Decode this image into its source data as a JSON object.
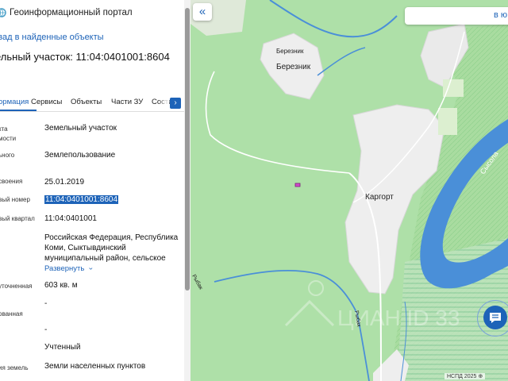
{
  "header": {
    "title": "Геоинформационный портал",
    "back_link": "зад в найденные объекты",
    "object_title": "ельный участок: 11:04:0401001:8604"
  },
  "tabs": [
    {
      "label": "ормация",
      "active": true
    },
    {
      "label": "Сервисы",
      "active": false
    },
    {
      "label": "Объекты",
      "active": false
    },
    {
      "label": "Части ЗУ",
      "active": false
    },
    {
      "label": "Соста",
      "active": false
    }
  ],
  "properties": [
    {
      "label1": "кта",
      "label2": "мости",
      "value": "Земельный участок"
    },
    {
      "label1": "ьного",
      "value": "Землепользование"
    },
    {
      "label1": "своения",
      "value": "25.01.2019"
    },
    {
      "label1": "вый номер",
      "value": "11:04:0401001:8604",
      "highlighted": true
    },
    {
      "label1": "вый квартал",
      "value": "11:04:0401001"
    },
    {
      "label1": "",
      "value_lines": [
        "Российская Федерация, Республика",
        "Коми, Сыктывдинский",
        "муниципальный район, сельское"
      ]
    },
    {
      "label1": "уточненная",
      "value": "603 кв. м"
    },
    {
      "label1": "ованная",
      "value": "-"
    },
    {
      "label1": "",
      "value": "-"
    },
    {
      "label1": "",
      "value": "Учтенный"
    },
    {
      "label1": "ия земель",
      "value": "Земли населенных пунктов"
    }
  ],
  "expand_link": "Развернуть",
  "map": {
    "collapse_icon": "double-chevron-left-icon",
    "search_hint": "в ю",
    "labels": {
      "village1_small": "Березник",
      "village1": "Березник",
      "village2": "Каргорт",
      "river": "Сысола",
      "creek1": "Рыбак",
      "creek2": "Рыбак"
    },
    "watermark": "ЦИАН ID 33",
    "attribution": "НСПД 2025 ⊕",
    "colors": {
      "forest": "#aee0a8",
      "settlement": "#eeeeee",
      "water": "#4a8fd8",
      "wetland": "#cfe9cf",
      "accent": "#1d63b8"
    }
  }
}
